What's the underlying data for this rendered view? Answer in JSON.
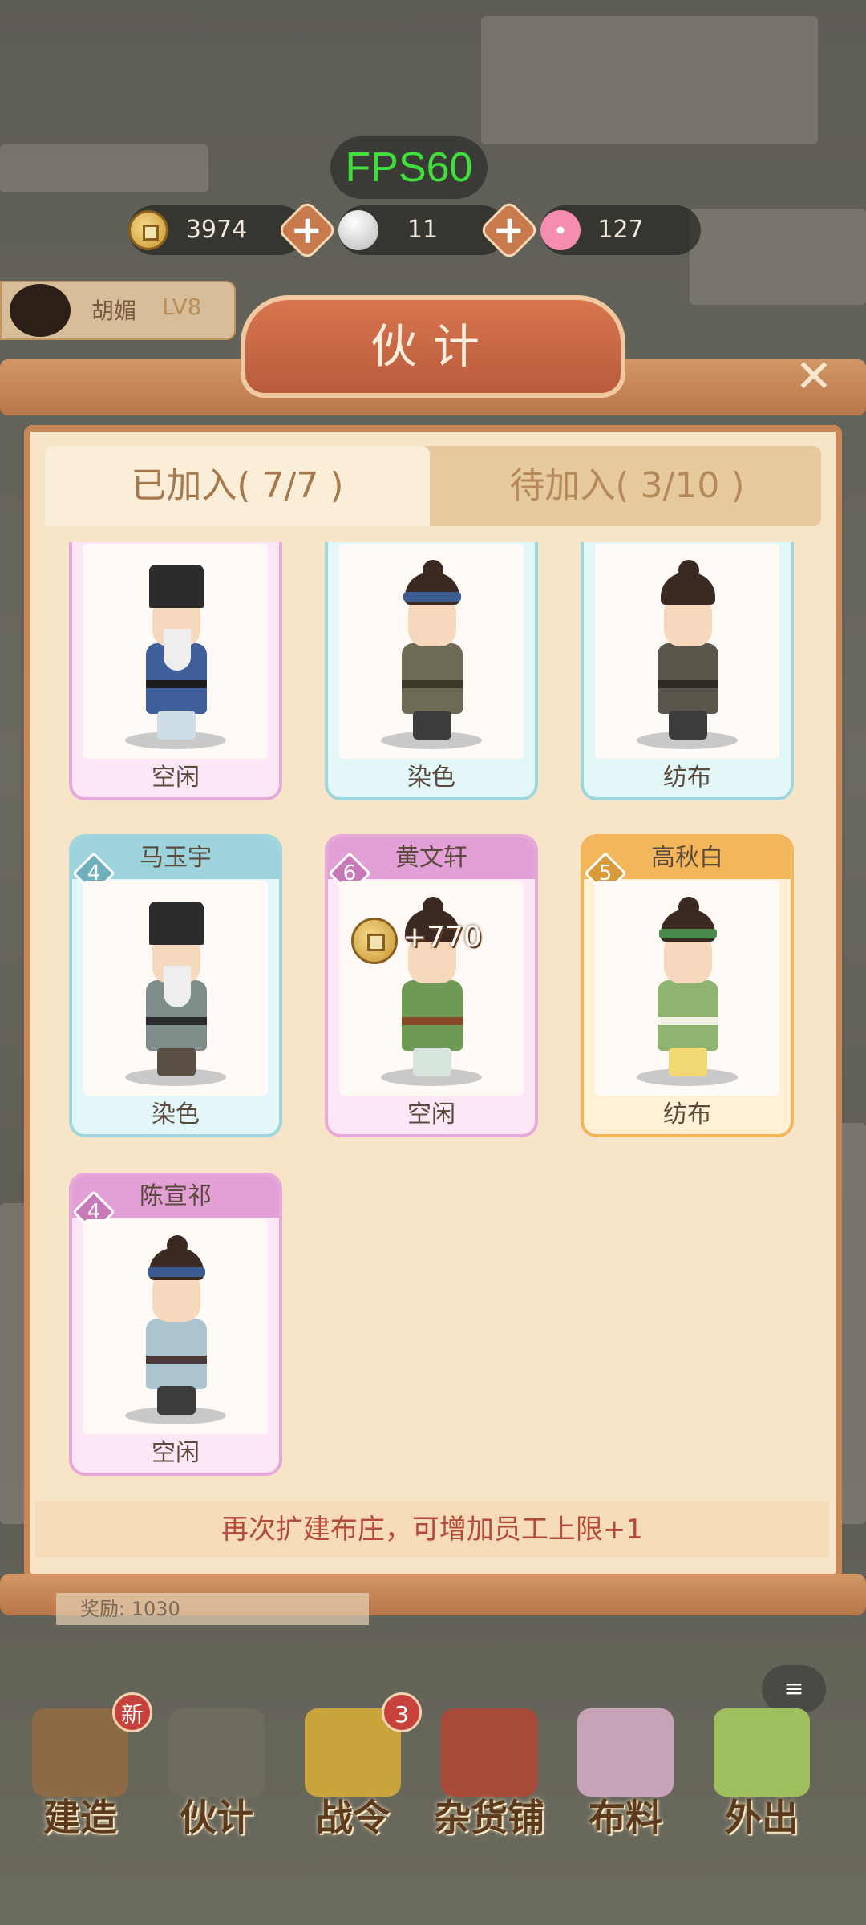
{
  "hud": {
    "fps": "FPS60",
    "coins": "3974",
    "silver": "11",
    "flowers": "127"
  },
  "player": {
    "name": "胡媚",
    "level": "LV8"
  },
  "panel": {
    "title": "伙计",
    "tabs": [
      {
        "label": "已加入(  7/7  )",
        "active": true
      },
      {
        "label": "待加入( 3/10 )",
        "active": false
      }
    ],
    "workers": [
      {
        "name": "",
        "level": "",
        "status": "空闲",
        "theme": "pink",
        "look": "elder-blue"
      },
      {
        "name": "",
        "level": "",
        "status": "染色",
        "theme": "cyan",
        "look": "youth-band"
      },
      {
        "name": "",
        "level": "",
        "status": "纺布",
        "theme": "cyan",
        "look": "youth-bun"
      },
      {
        "name": "马玉宇",
        "level": "4",
        "status": "染色",
        "theme": "cyan",
        "look": "elder-grey"
      },
      {
        "name": "黄文轩",
        "level": "6",
        "status": "空闲",
        "theme": "pink",
        "look": "youth-green"
      },
      {
        "name": "高秋白",
        "level": "5",
        "status": "纺布",
        "theme": "gold",
        "look": "girl-green"
      },
      {
        "name": "陈宣祁",
        "level": "4",
        "status": "空闲",
        "theme": "pink",
        "look": "youth-light"
      }
    ],
    "income_popup": "+770",
    "footer_tip": "再次扩建布庄，可增加员工上限+1"
  },
  "under_strip": "奖励: 1030",
  "nav": [
    {
      "label": "建造",
      "badge": "新"
    },
    {
      "label": "伙计",
      "badge": ""
    },
    {
      "label": "战令",
      "badge": "3"
    },
    {
      "label": "杂货铺",
      "badge": ""
    },
    {
      "label": "布料",
      "badge": ""
    },
    {
      "label": "外出",
      "badge": ""
    }
  ],
  "colors": {
    "accent": "#c98757",
    "title_plate": "#d8754f",
    "panel_bg": "#f8e4c8",
    "fps_green": "#3fe03a",
    "tip_red": "#b44a3a"
  },
  "icons": [
    "coin-icon",
    "silver-ingot-icon",
    "flower-icon",
    "plus-icon",
    "close-icon",
    "chat-icon"
  ]
}
